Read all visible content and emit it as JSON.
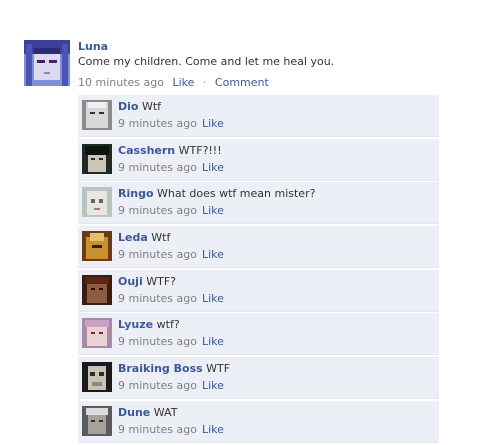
{
  "post": {
    "author": "Luna",
    "text": "Come my children. Come and let me heal you.",
    "time": "10 minutes ago",
    "like_label": "Like",
    "separator": "·",
    "comment_label": "Comment"
  },
  "comments": [
    {
      "name": "Dio",
      "text": "Wtf",
      "time": "9 minutes ago",
      "like": "Like"
    },
    {
      "name": "Casshern",
      "text": "WTF?!!!",
      "time": "9 minutes ago",
      "like": "Like"
    },
    {
      "name": "Ringo",
      "text": "What does wtf mean mister?",
      "time": "9 minutes ago",
      "like": "Like"
    },
    {
      "name": "Leda",
      "text": "Wtf",
      "time": "9 minutes ago",
      "like": "Like"
    },
    {
      "name": "Ouji",
      "text": "WTF?",
      "time": "9 minutes ago",
      "like": "Like"
    },
    {
      "name": "Lyuze",
      "text": "wtf?",
      "time": "9 minutes ago",
      "like": "Like"
    },
    {
      "name": "Braiking Boss",
      "text": "WTF",
      "time": "9 minutes ago",
      "like": "Like"
    },
    {
      "name": "Dune",
      "text": "WAT",
      "time": "9 minutes ago",
      "like": "Like"
    }
  ]
}
